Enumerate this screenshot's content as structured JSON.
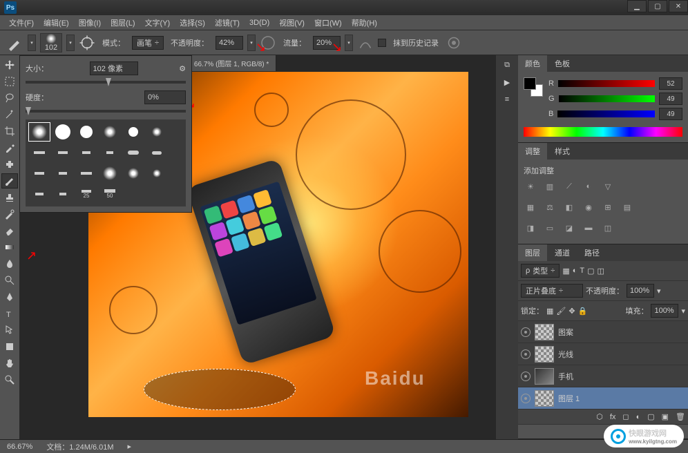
{
  "app": {
    "logo": "Ps"
  },
  "menu": [
    "文件(F)",
    "编辑(E)",
    "图像(I)",
    "图层(L)",
    "文字(Y)",
    "选择(S)",
    "滤镜(T)",
    "3D(D)",
    "视图(V)",
    "窗口(W)",
    "帮助(H)"
  ],
  "win_controls": {
    "min": "▁",
    "max": "▢",
    "close": "✕"
  },
  "optbar": {
    "brush_size": "102",
    "mode_label": "模式：",
    "mode_value": "画笔",
    "opacity_label": "不透明度：",
    "opacity_value": "42%",
    "flow_label": "流量：",
    "flow_value": "20%",
    "history_label": "抹到历史记录"
  },
  "doc_tab": "@ 66.7% (图层 1, RGB/8) *",
  "brush_panel": {
    "size_label": "大小：",
    "size_value": "102 像素",
    "hardness_label": "硬度：",
    "hardness_value": "0%",
    "labels": [
      "25",
      "50"
    ]
  },
  "panels": {
    "color": {
      "tab1": "颜色",
      "tab2": "色板",
      "r": "R",
      "g": "G",
      "b": "B",
      "rv": "52",
      "gv": "49",
      "bv": "49"
    },
    "adjust": {
      "tab1": "调整",
      "tab2": "样式",
      "title": "添加调整"
    },
    "layers": {
      "tab1": "图层",
      "tab2": "通道",
      "tab3": "路径",
      "type": "类型",
      "blend": "正片叠底",
      "opacity_lbl": "不透明度：",
      "opacity": "100%",
      "lock_lbl": "锁定：",
      "fill_lbl": "填充：",
      "fill": "100%",
      "items": [
        "图案",
        "光线",
        "手机",
        "图层 1"
      ]
    }
  },
  "status": {
    "zoom": "66.67%",
    "doc": "文档：1.24M/6.01M"
  },
  "watermark": {
    "text": "Baidu",
    "logo_text": "快眼游戏网",
    "logo_url": "www.kyilgtng.com"
  }
}
